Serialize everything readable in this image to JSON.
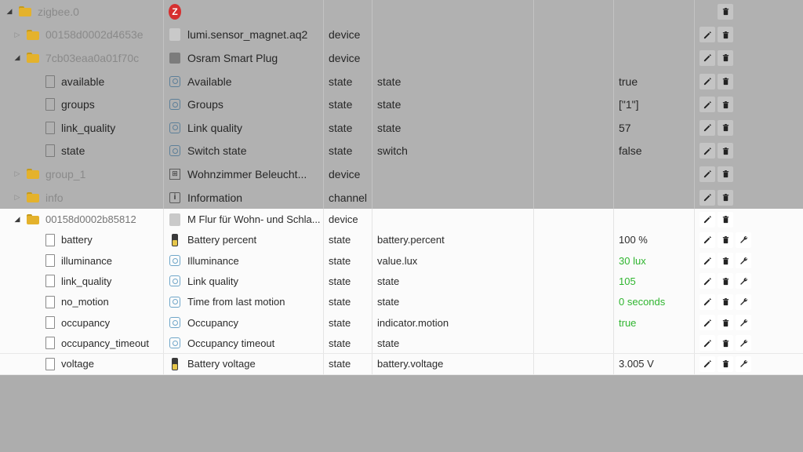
{
  "rows": [
    {
      "id": "zigbee.0",
      "name": "",
      "type": "",
      "role": "",
      "value": "",
      "value_green": false,
      "icon": "zigbee-logo-icon",
      "depth": 0,
      "expander": "open",
      "node": "folder",
      "dim": true,
      "id_muted": true,
      "actions": [
        "delete"
      ]
    },
    {
      "id": "00158d0002d4653e",
      "name": "lumi.sensor_magnet.aq2",
      "type": "device",
      "role": "",
      "value": "",
      "value_green": false,
      "icon": "device-image-icon",
      "depth": 1,
      "expander": "closed",
      "node": "folder",
      "dim": true,
      "id_muted": true,
      "actions": [
        "edit",
        "delete"
      ]
    },
    {
      "id": "7cb03eaa0a01f70c",
      "name": "Osram Smart Plug",
      "type": "device",
      "role": "",
      "value": "",
      "value_green": false,
      "icon": "plug-icon",
      "depth": 1,
      "expander": "open",
      "node": "folder",
      "dim": true,
      "id_muted": true,
      "actions": [
        "edit",
        "delete"
      ]
    },
    {
      "id": "available",
      "name": "Available",
      "type": "state",
      "role": "state",
      "value": "true",
      "value_green": false,
      "icon": "state-icon",
      "depth": 2,
      "expander": "none",
      "node": "file",
      "dim": true,
      "id_muted": false,
      "actions": [
        "edit",
        "delete"
      ]
    },
    {
      "id": "groups",
      "name": "Groups",
      "type": "state",
      "role": "state",
      "value": "[\"1\"]",
      "value_green": false,
      "icon": "state-icon",
      "depth": 2,
      "expander": "none",
      "node": "file",
      "dim": true,
      "id_muted": false,
      "actions": [
        "edit",
        "delete"
      ]
    },
    {
      "id": "link_quality",
      "name": "Link quality",
      "type": "state",
      "role": "state",
      "value": "57",
      "value_green": false,
      "icon": "state-icon",
      "depth": 2,
      "expander": "none",
      "node": "file",
      "dim": true,
      "id_muted": false,
      "actions": [
        "edit",
        "delete"
      ]
    },
    {
      "id": "state",
      "name": "Switch state",
      "type": "state",
      "role": "switch",
      "value": "false",
      "value_green": false,
      "icon": "state-icon",
      "depth": 2,
      "expander": "none",
      "node": "file",
      "dim": true,
      "id_muted": false,
      "actions": [
        "edit",
        "delete"
      ]
    },
    {
      "id": "group_1",
      "name": "Wohnzimmer Beleucht...",
      "type": "device",
      "role": "",
      "value": "",
      "value_green": false,
      "icon": "group-icon",
      "depth": 1,
      "expander": "closed",
      "node": "folder",
      "dim": true,
      "id_muted": true,
      "actions": [
        "edit",
        "delete"
      ]
    },
    {
      "id": "info",
      "name": "Information",
      "type": "channel",
      "role": "",
      "value": "",
      "value_green": false,
      "icon": "info-icon",
      "depth": 1,
      "expander": "closed",
      "node": "folder",
      "dim": true,
      "id_muted": true,
      "actions": [
        "edit",
        "delete"
      ]
    },
    {
      "id": "00158d0002b85812",
      "name": "M Flur für Wohn- und Schla...",
      "type": "device",
      "role": "",
      "value": "",
      "value_green": false,
      "icon": "device-image-icon",
      "depth": 1,
      "expander": "open",
      "node": "folder",
      "dim": false,
      "id_muted": true,
      "actions": [
        "edit",
        "delete"
      ]
    },
    {
      "id": "battery",
      "name": "Battery percent",
      "type": "state",
      "role": "battery.percent",
      "value": "100 %",
      "value_green": false,
      "icon": "battery-icon",
      "depth": 2,
      "expander": "none",
      "node": "file",
      "dim": false,
      "id_muted": false,
      "actions": [
        "edit",
        "delete",
        "wrench"
      ]
    },
    {
      "id": "illuminance",
      "name": "Illuminance",
      "type": "state",
      "role": "value.lux",
      "value": "30 lux",
      "value_green": true,
      "icon": "state-icon",
      "depth": 2,
      "expander": "none",
      "node": "file",
      "dim": false,
      "id_muted": false,
      "actions": [
        "edit",
        "delete",
        "wrench"
      ]
    },
    {
      "id": "link_quality",
      "name": "Link quality",
      "type": "state",
      "role": "state",
      "value": "105",
      "value_green": true,
      "icon": "state-icon",
      "depth": 2,
      "expander": "none",
      "node": "file",
      "dim": false,
      "id_muted": false,
      "actions": [
        "edit",
        "delete",
        "wrench"
      ]
    },
    {
      "id": "no_motion",
      "name": "Time from last motion",
      "type": "state",
      "role": "state",
      "value": "0 seconds",
      "value_green": true,
      "icon": "state-icon",
      "depth": 2,
      "expander": "none",
      "node": "file",
      "dim": false,
      "id_muted": false,
      "actions": [
        "edit",
        "delete",
        "wrench"
      ]
    },
    {
      "id": "occupancy",
      "name": "Occupancy",
      "type": "state",
      "role": "indicator.motion",
      "value": "true",
      "value_green": true,
      "icon": "state-icon",
      "depth": 2,
      "expander": "none",
      "node": "file",
      "dim": false,
      "id_muted": false,
      "actions": [
        "edit",
        "delete",
        "wrench"
      ]
    },
    {
      "id": "occupancy_timeout",
      "name": "Occupancy timeout",
      "type": "state",
      "role": "state",
      "value": "",
      "value_green": false,
      "icon": "state-icon",
      "depth": 2,
      "expander": "none",
      "node": "file",
      "dim": false,
      "id_muted": false,
      "actions": [
        "edit",
        "delete",
        "wrench"
      ]
    },
    {
      "id": "voltage",
      "name": "Battery voltage",
      "type": "state",
      "role": "battery.voltage",
      "value": "3.005 V",
      "value_green": false,
      "icon": "battery-icon",
      "depth": 2,
      "expander": "none",
      "node": "file",
      "dim": false,
      "id_muted": false,
      "actions": [
        "edit",
        "delete",
        "wrench"
      ]
    }
  ],
  "icons": {
    "zigbee-logo-icon": "Z",
    "group-icon": "⊞",
    "info-icon": "i"
  },
  "colors": {
    "dim_background": "#b1b1b1",
    "bright_background": "#fbfbfb",
    "value_green": "#2fb52f",
    "folder": "#e4b22c"
  }
}
